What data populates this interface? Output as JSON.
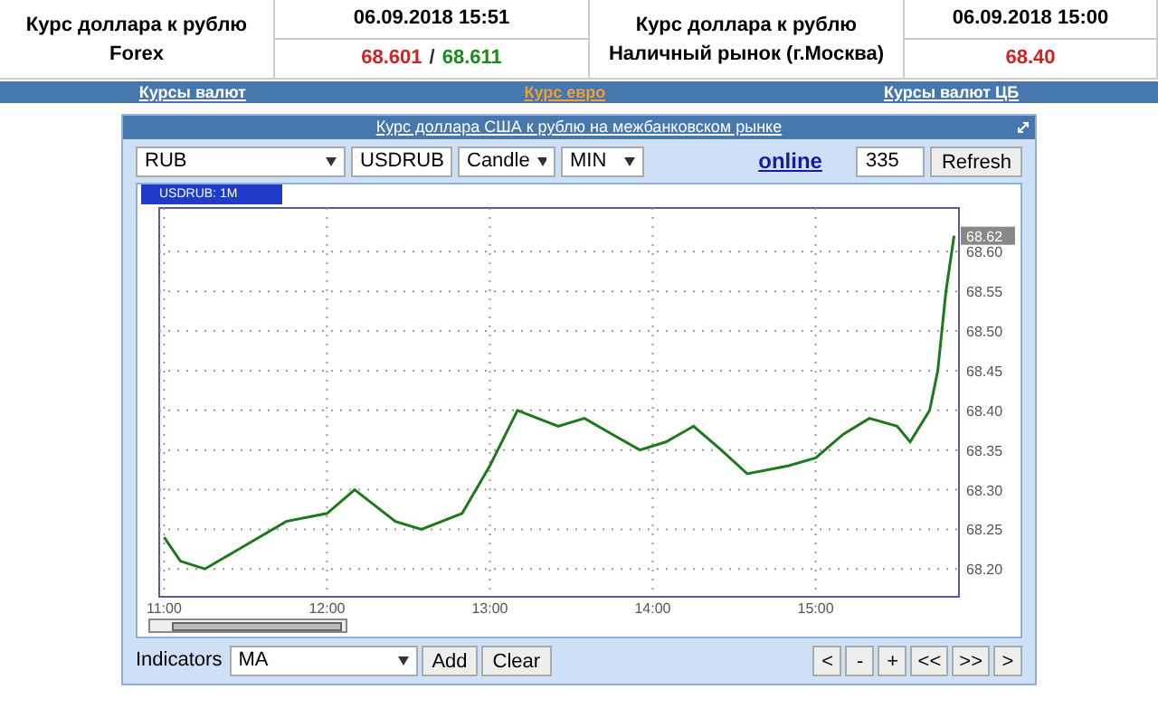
{
  "header": [
    {
      "title": "Курс доллара к рублю",
      "subtitle": "Forex",
      "datetime": "06.09.2018 15:51",
      "separator": "/",
      "values": [
        {
          "text": "68.601",
          "color": "#d42020"
        },
        {
          "text": "68.611",
          "color": "#1a8a1a"
        }
      ]
    },
    {
      "title": "Курс доллара к рублю",
      "subtitle": "Наличный рынок (г.Москва)",
      "datetime": "06.09.2018 15:00",
      "values": [
        {
          "text": "68.40",
          "color": "#d42020"
        }
      ]
    }
  ],
  "nav": [
    {
      "label": "Курсы валют",
      "selected": false
    },
    {
      "label": "Курс евро",
      "selected": true
    },
    {
      "label": "Курсы валют ЦБ",
      "selected": false
    }
  ],
  "panel": {
    "title": "Курс доллара США к рублю на межбанковском рынке",
    "toolbar": {
      "selects": [
        "RUB",
        "USDRUB",
        "Candle",
        "MIN"
      ],
      "online_link": "online",
      "count": "335",
      "refresh": "Refresh"
    },
    "legend_suffix": ": 1M",
    "chart_data": {
      "type": "line",
      "grid": true,
      "x": [
        11.0,
        11.1,
        11.25,
        11.5,
        11.75,
        12.0,
        12.17,
        12.42,
        12.58,
        12.83,
        13.0,
        13.17,
        13.42,
        13.58,
        13.75,
        13.92,
        14.08,
        14.25,
        14.42,
        14.58,
        14.83,
        15.0,
        15.17,
        15.33,
        15.5,
        15.58,
        15.7,
        15.75,
        15.8,
        15.85
      ],
      "series": [
        {
          "name": "USDRUB",
          "color": "#1a7a1a",
          "values": [
            68.24,
            68.21,
            68.2,
            68.23,
            68.26,
            68.27,
            68.3,
            68.26,
            68.25,
            68.27,
            68.33,
            68.4,
            68.38,
            68.39,
            68.37,
            68.35,
            68.36,
            68.38,
            68.35,
            68.32,
            68.33,
            68.34,
            68.37,
            68.39,
            68.38,
            68.36,
            68.4,
            68.45,
            68.55,
            68.62
          ]
        }
      ],
      "xlim": [
        10.97,
        15.88
      ],
      "ylim": [
        68.165,
        68.655
      ],
      "xticks": [
        {
          "value": 11,
          "label": "11:00"
        },
        {
          "value": 12,
          "label": "12:00"
        },
        {
          "value": 13,
          "label": "13:00"
        },
        {
          "value": 14,
          "label": "14:00"
        },
        {
          "value": 15,
          "label": "15:00"
        }
      ],
      "yticks": [
        {
          "value": 68.2,
          "label": "68.20"
        },
        {
          "value": 68.25,
          "label": "68.25"
        },
        {
          "value": 68.3,
          "label": "68.30"
        },
        {
          "value": 68.35,
          "label": "68.35"
        },
        {
          "value": 68.4,
          "label": "68.40"
        },
        {
          "value": 68.45,
          "label": "68.45"
        },
        {
          "value": 68.5,
          "label": "68.50"
        },
        {
          "value": 68.55,
          "label": "68.55"
        },
        {
          "value": 68.6,
          "label": "68.60"
        }
      ],
      "annotations": [
        {
          "x": 15.88,
          "y": 68.62,
          "text": "68.62"
        }
      ]
    },
    "bottom": {
      "label": "Indicators",
      "select": "MA",
      "buttons": [
        "Add",
        "Clear"
      ],
      "nav_buttons": [
        "<",
        "-",
        "+",
        "<<",
        ">>",
        ">"
      ]
    }
  }
}
